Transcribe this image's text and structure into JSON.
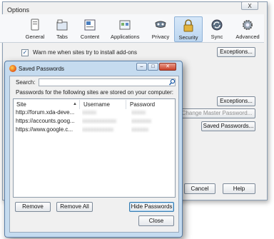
{
  "options": {
    "title": "Options",
    "close_label": "X",
    "toolbar": [
      {
        "label": "General",
        "icon": "general-icon"
      },
      {
        "label": "Tabs",
        "icon": "tabs-icon"
      },
      {
        "label": "Content",
        "icon": "content-icon"
      },
      {
        "label": "Applications",
        "icon": "applications-icon"
      },
      {
        "label": "Privacy",
        "icon": "privacy-icon"
      },
      {
        "label": "Security",
        "icon": "lock-icon",
        "active": true
      },
      {
        "label": "Sync",
        "icon": "sync-icon"
      },
      {
        "label": "Advanced",
        "icon": "gear-icon"
      }
    ],
    "warn_addons": {
      "label": "Warn me when sites try to install add-ons",
      "checked": true
    },
    "exceptions_top": "Exceptions...",
    "exceptions_mid": "Exceptions...",
    "change_master_password": "Change Master Password...",
    "saved_passwords": "Saved Passwords...",
    "cancel": "Cancel",
    "help": "Help"
  },
  "saved_passwords_dialog": {
    "title": "Saved Passwords",
    "search_label": "Search:",
    "search_value": "",
    "description": "Passwords for the following sites are stored on your computer:",
    "columns": {
      "site": "Site",
      "username": "Username",
      "password": "Password"
    },
    "rows": [
      {
        "site": "http://forum.xda-deve...",
        "username": "",
        "password": ""
      },
      {
        "site": "https://accounts.goog...",
        "username": "",
        "password": ""
      },
      {
        "site": "https://www.google.c...",
        "username": "",
        "password": ""
      }
    ],
    "remove": "Remove",
    "remove_all": "Remove All",
    "hide_passwords": "Hide Passwords",
    "close": "Close"
  },
  "colors": {
    "accent": "#3c7fb1",
    "dialog_frame": "#c5dbef"
  }
}
